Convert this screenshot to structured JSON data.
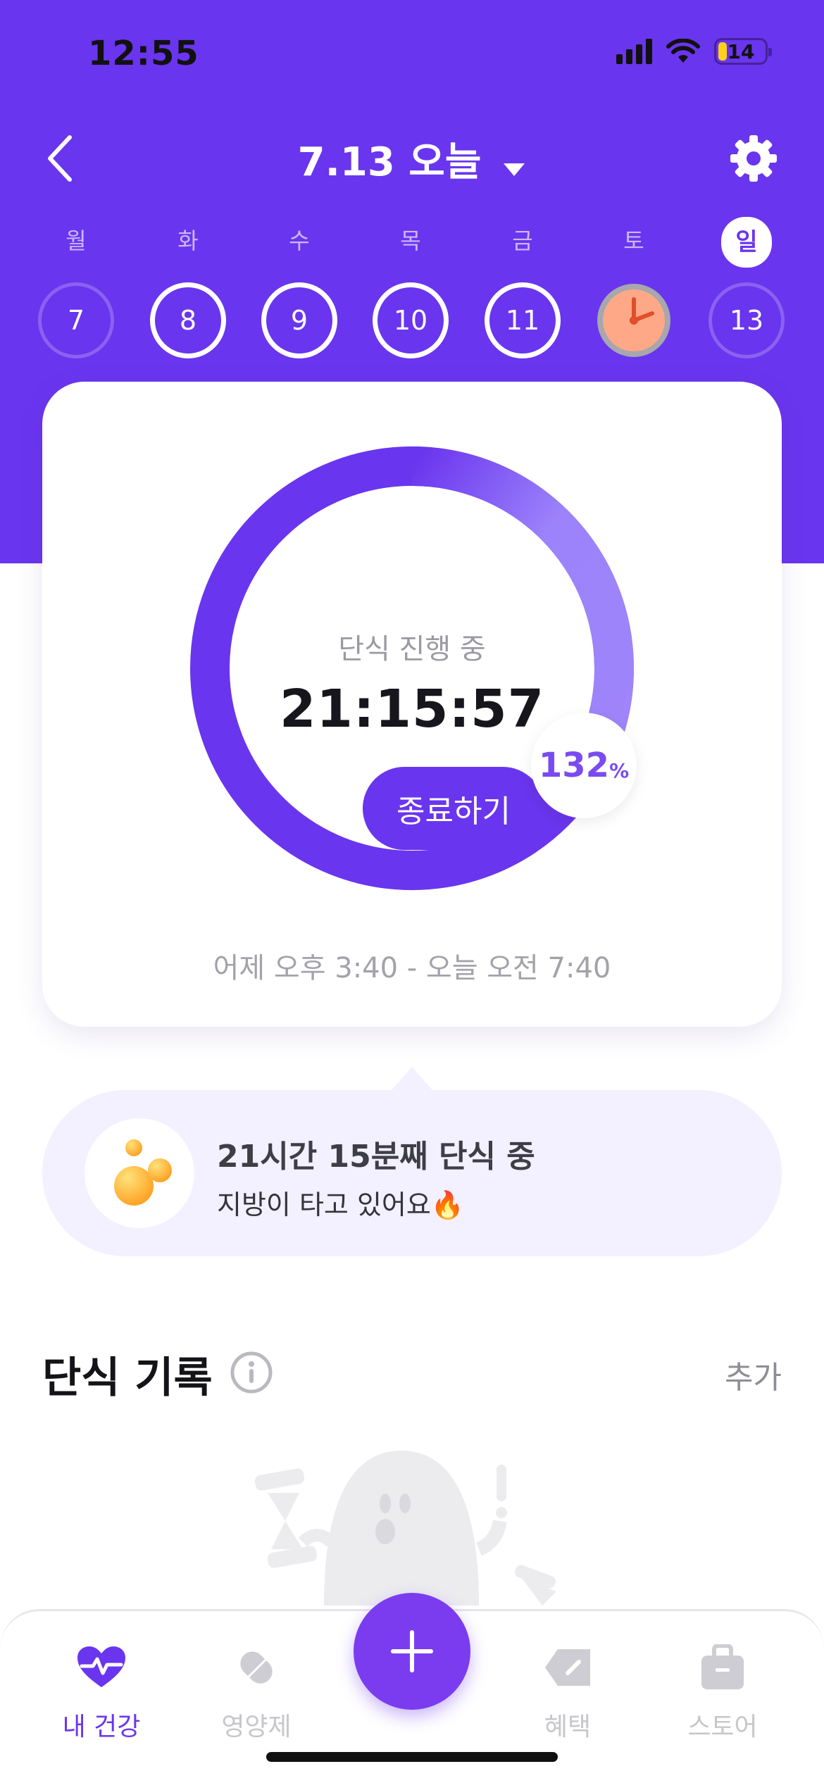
{
  "status_bar": {
    "time": "12:55",
    "battery": "14"
  },
  "header": {
    "title": "7.13 오늘"
  },
  "week": {
    "day_labels": [
      "월",
      "화",
      "수",
      "목",
      "금",
      "토",
      "일"
    ],
    "dates": [
      "7",
      "8",
      "9",
      "10",
      "11",
      "",
      "13"
    ],
    "today_index": 6
  },
  "fasting_card": {
    "status_label": "단식 진행 중",
    "elapsed": "21:15:57",
    "end_button": "종료하기",
    "percent_value": "132",
    "percent_unit": "%",
    "progress_fraction": 1.32,
    "time_range": "어제 오후 3:40 - 오늘 오전 7:40"
  },
  "message": {
    "title": "21시간 15분째 단식 중",
    "subtitle": "지방이 타고 있어요🔥"
  },
  "records": {
    "title": "단식 기록",
    "add_label": "추가"
  },
  "tabbar": {
    "tabs": [
      {
        "label": "내 건강",
        "icon": "heart-pulse-icon",
        "active": true
      },
      {
        "label": "영양제",
        "icon": "pill-icon",
        "active": false
      },
      {
        "label": "혜택",
        "icon": "tag-icon",
        "active": false
      },
      {
        "label": "스토어",
        "icon": "bag-icon",
        "active": false
      }
    ]
  },
  "colors": {
    "brand": "#6a35ee",
    "bubble": "#f3f0ff",
    "ring_light": "#9f84fa"
  }
}
